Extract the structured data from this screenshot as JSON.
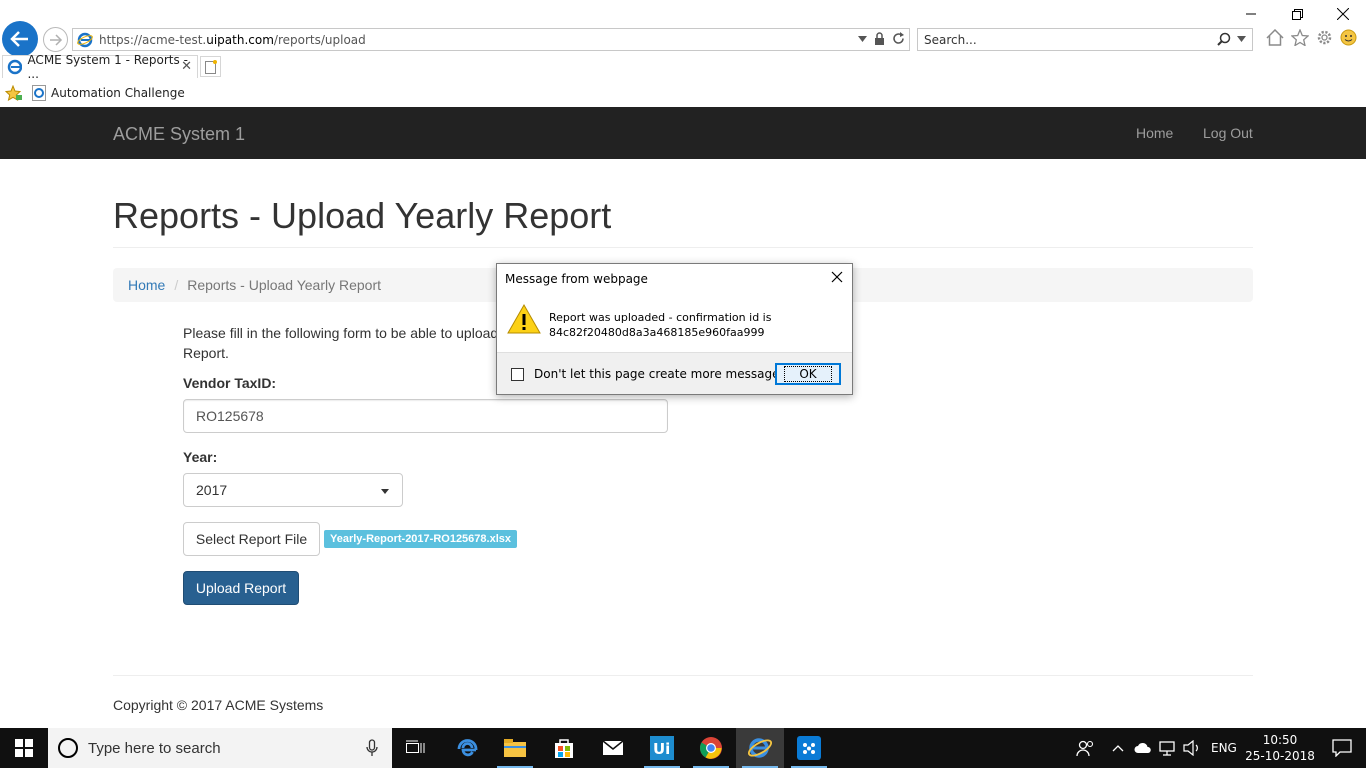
{
  "browser": {
    "url_prefix": "https://acme-test.",
    "url_domain": "uipath.com",
    "url_path": "/reports/upload",
    "search_placeholder": "Search...",
    "tab_title": "ACME System 1 - Reports - ...",
    "favorites": [
      "Automation Challenge"
    ]
  },
  "navbar": {
    "brand": "ACME System 1",
    "links": [
      "Home",
      "Log Out"
    ]
  },
  "page": {
    "title": "Reports - Upload Yearly Report",
    "breadcrumb": {
      "home": "Home",
      "separator": "/",
      "current": "Reports - Upload Yearly Report"
    },
    "intro": "Please fill in the following form to be able to upload",
    "intro_line2": "Report.",
    "vendor_label": "Vendor TaxID:",
    "vendor_value": "RO125678",
    "year_label": "Year:",
    "year_value": "2017",
    "select_file_label": "Select Report File",
    "file_name": "Yearly-Report-2017-RO125678.xlsx",
    "upload_label": "Upload Report",
    "footer": "Copyright © 2017 ACME Systems"
  },
  "dialog": {
    "title": "Message from webpage",
    "message_line1": "Report was uploaded - confirmation id is",
    "message_line2": "84c82f20480d8a3a468185e960faa999",
    "checkbox_label": "Don't let this page create more messages",
    "ok_label": "OK"
  },
  "taskbar": {
    "search_placeholder": "Type here to search",
    "language": "ENG",
    "time": "10:50",
    "date": "25-10-2018"
  },
  "colors": {
    "navbar_bg": "#222222",
    "link": "#337ab7",
    "primary_button": "#286090",
    "file_badge": "#5bc0de",
    "ie_blue": "#1a73c8"
  }
}
